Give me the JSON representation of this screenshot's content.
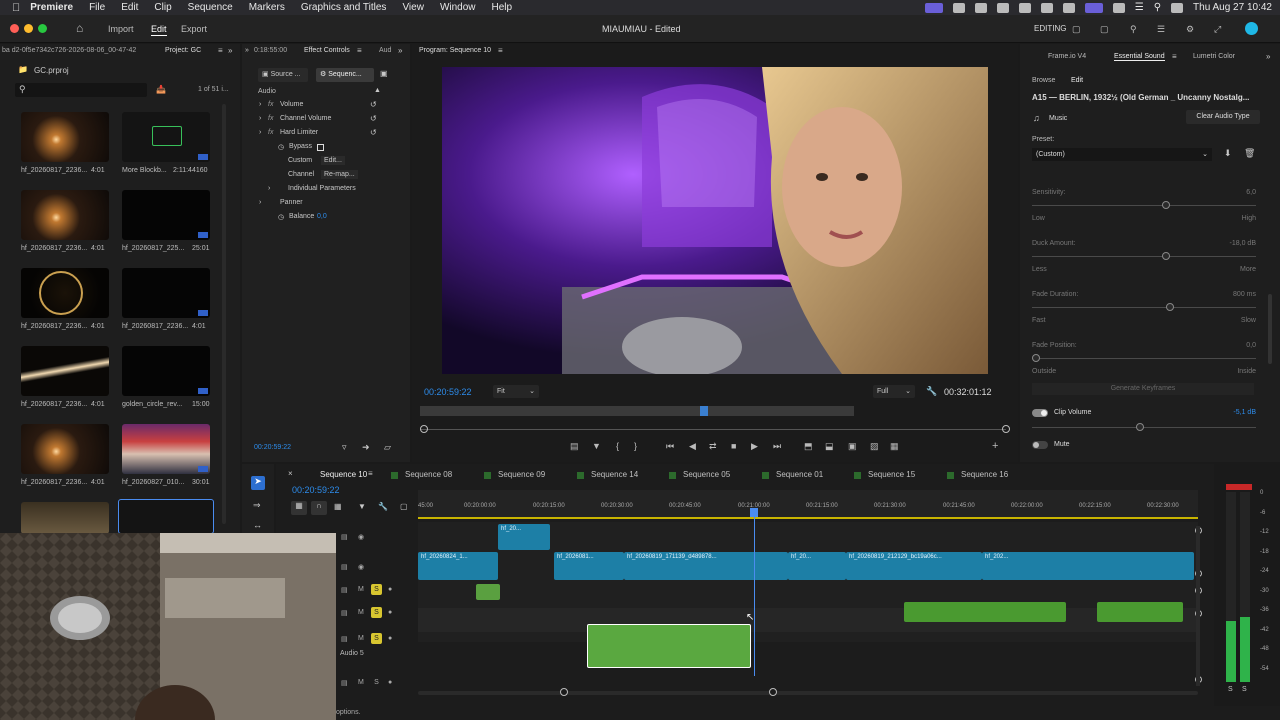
{
  "menubar": {
    "app": "Premiere",
    "items": [
      "File",
      "Edit",
      "Clip",
      "Sequence",
      "Markers",
      "Graphics and Titles",
      "View",
      "Window",
      "Help"
    ],
    "clock": "Thu Aug 27  10:42"
  },
  "titlebar": {
    "nav": [
      "Import",
      "Edit",
      "Export"
    ],
    "active_nav": "Edit",
    "doc_title": "MIAUMIAU - Edited",
    "workspace": "EDITING"
  },
  "project_panel": {
    "breadcrumb": "ba d2-0f5e7342c726-2026-08-06_00-47-42",
    "tab": "Project: GC",
    "file": "GC.prproj",
    "count": "1 of 51 i...",
    "items": [
      {
        "name": "hf_20260817_2236...",
        "dur": "4:01",
        "kind": "flare"
      },
      {
        "name": "More Blockb...",
        "dur": "2:11:44160",
        "kind": "audio"
      },
      {
        "name": "hf_20260817_2236...",
        "dur": "4:01",
        "kind": "flare"
      },
      {
        "name": "hf_20260817_225...",
        "dur": "25:01",
        "kind": "dark"
      },
      {
        "name": "hf_20260817_2236...",
        "dur": "4:01",
        "kind": "circle"
      },
      {
        "name": "hf_20260817_2236...",
        "dur": "4:01",
        "kind": "dark"
      },
      {
        "name": "hf_20260817_2236...",
        "dur": "4:01",
        "kind": "beam"
      },
      {
        "name": "golden_circle_rev...",
        "dur": "15:00",
        "kind": "dark"
      },
      {
        "name": "hf_20260817_2236...",
        "dur": "4:01",
        "kind": "flare"
      },
      {
        "name": "hf_20260827_010...",
        "dur": "30:01",
        "kind": "person"
      }
    ]
  },
  "effect_controls": {
    "left_timecode": "0:18:55:00",
    "tabs": [
      "Effect Controls",
      "Aud"
    ],
    "subtabs": [
      "Source ...",
      "Sequenc..."
    ],
    "section": "Audio",
    "rows": [
      {
        "label": "Volume",
        "indent": 1,
        "fx": true
      },
      {
        "label": "Channel Volume",
        "indent": 1,
        "fx": true
      },
      {
        "label": "Hard Limiter",
        "indent": 1,
        "fx": true
      },
      {
        "label": "Bypass",
        "indent": 2
      },
      {
        "label": "Custom",
        "indent": 2,
        "extra": "Edit..."
      },
      {
        "label": "Channel",
        "indent": 2,
        "extra": "Re-map..."
      },
      {
        "label": "Individual Parameters",
        "indent": 2
      },
      {
        "label": "Panner",
        "indent": 1
      },
      {
        "label": "Balance",
        "indent": 2,
        "value": "0,0"
      }
    ],
    "bottom_timecode": "00:20:59:22"
  },
  "program_monitor": {
    "title": "Program: Sequence 10",
    "timecode": "00:20:59:22",
    "zoom": "Fit",
    "quality": "Full",
    "duration": "00:32:01:12"
  },
  "right_panel": {
    "tabs": [
      "Frame.io V4",
      "Essential Sound",
      "Lumetri Color"
    ],
    "active_tab": "Essential Sound",
    "subtabs": [
      "Browse",
      "Edit"
    ],
    "clip_name": "A15 — BERLIN, 1932½ (Old German _ Uncanny Nostalg...",
    "type": "Music",
    "clear_btn": "Clear Audio Type",
    "preset_label": "Preset:",
    "preset_value": "(Custom)",
    "sliders": [
      {
        "label": "Sensitivity:",
        "value": "6,0",
        "lo": "Low",
        "hi": "High",
        "pos": 0.6
      },
      {
        "label": "Duck Amount:",
        "value": "-18,0 dB",
        "lo": "Less",
        "hi": "More",
        "pos": 0.6
      },
      {
        "label": "Fade Duration:",
        "value": "800 ms",
        "lo": "Fast",
        "hi": "Slow",
        "pos": 0.62
      },
      {
        "label": "Fade Position:",
        "value": "0,0",
        "lo": "Outside",
        "hi": "Inside",
        "pos": 0.0
      }
    ],
    "generate_btn": "Generate Keyframes",
    "clip_volume_label": "Clip Volume",
    "clip_volume_value": "-5,1 dB",
    "clip_volume_pos": 0.48,
    "mute_label": "Mute"
  },
  "timeline": {
    "sequence_tabs": [
      "Sequence 10",
      "Sequence 08",
      "Sequence 09",
      "Sequence 14",
      "Sequence 05",
      "Sequence 01",
      "Sequence 15",
      "Sequence 16"
    ],
    "timecode": "00:20:59:22",
    "ruler": [
      "45:00",
      "00:20:00:00",
      "00:20:15:00",
      "00:20:30:00",
      "00:20:45:00",
      "00:21:00:00",
      "00:21:15:00",
      "00:21:30:00",
      "00:21:45:00",
      "00:22:00:00",
      "00:22:15:00",
      "00:22:30:00"
    ],
    "video_clips": [
      "hf_20260824_1...",
      "hf_2026081...",
      "hf_20260819_171139_d489878...",
      "hf_20...",
      "hf_20260819_212129_bc19a06c...",
      "hf_202..."
    ],
    "top_clip": "hf_20...",
    "audio5_label": "Audio 5",
    "status": "options."
  },
  "meters": {
    "labels": [
      "0",
      "-6",
      "-12",
      "-18",
      "-24",
      "-30",
      "-36",
      "-42",
      "-48",
      "-54"
    ],
    "level_l": 0.32,
    "level_r": 0.34
  },
  "colors": {
    "accent_blue": "#2d8ceb",
    "clip_video": "#1d7fa6",
    "clip_audio": "#3e7a2e",
    "solo_yellow": "#d8c630"
  }
}
